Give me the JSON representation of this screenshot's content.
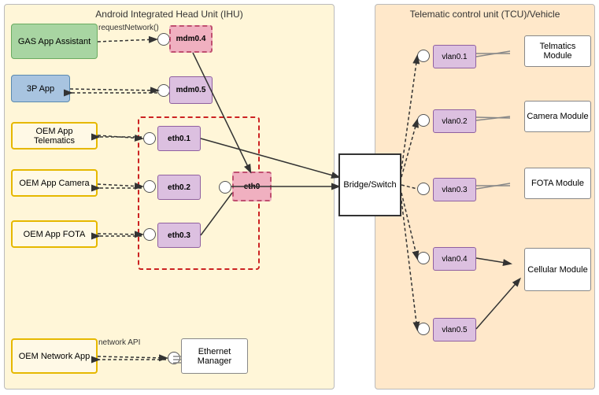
{
  "ihu": {
    "title": "Android Integrated Head Unit (IHU)",
    "apps": {
      "gas": "GAS App Assistant",
      "app3p": "3P App",
      "oemTelematics": "OEM App Telematics",
      "oemCamera": "OEM App Camera",
      "oemFota": "OEM App FOTA",
      "oemNetwork": "OEM Network App"
    },
    "nodes": {
      "mdm04": "mdm0.4",
      "mdm05": "mdm0.5",
      "eth01": "eth0.1",
      "eth02": "eth0.2",
      "eth03": "eth0.3",
      "eth0": "eth0"
    },
    "labels": {
      "requestNetwork": "requestNetwork()",
      "networkAPI": "network API"
    },
    "ethernetManager": "Ethernet Manager"
  },
  "bridge": {
    "label": "Bridge/Switch"
  },
  "tcu": {
    "title": "Telematic control unit (TCU)/Vehicle",
    "vlans": {
      "vlan01": "vlan0.1",
      "vlan02": "vlan0.2",
      "vlan03": "vlan0.3",
      "vlan04": "vlan0.4",
      "vlan05": "vlan0.5"
    },
    "modules": {
      "telematics": "Telmatics Module",
      "camera": "Camera Module",
      "fota": "FOTA Module",
      "cellular": "Cellular Module"
    }
  }
}
